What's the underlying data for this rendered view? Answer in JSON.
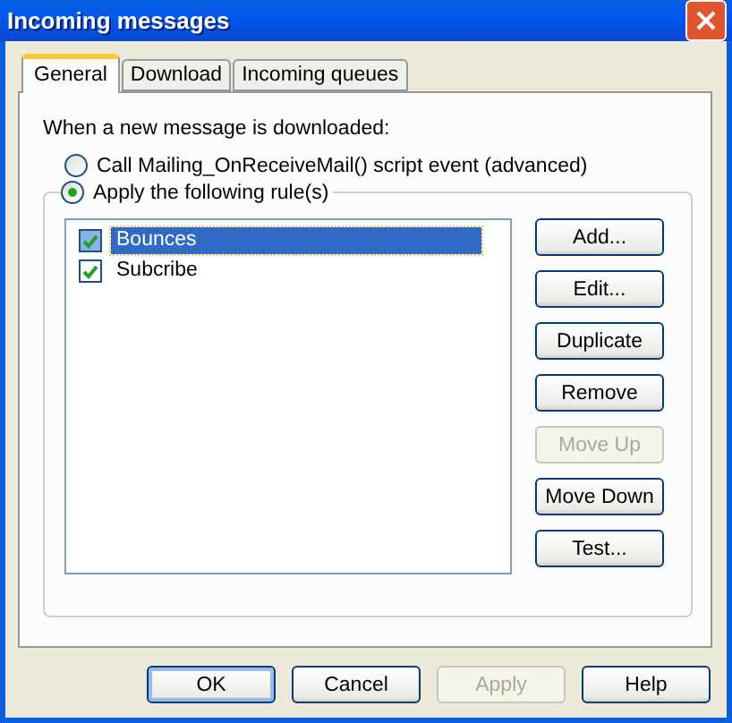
{
  "window": {
    "title": "Incoming messages"
  },
  "tabs": [
    {
      "label": "General",
      "selected": true
    },
    {
      "label": "Download",
      "selected": false
    },
    {
      "label": "Incoming queues",
      "selected": false
    }
  ],
  "intro": "When a new message is downloaded:",
  "options": [
    {
      "label": "Call Mailing_OnReceiveMail() script event (advanced)",
      "selected": false
    },
    {
      "label": "Apply the following rule(s)",
      "selected": true
    }
  ],
  "rules": [
    {
      "name": "Bounces",
      "checked": true,
      "selected": true
    },
    {
      "name": "Subcribe",
      "checked": true,
      "selected": false
    }
  ],
  "rule_buttons": [
    {
      "label": "Add...",
      "disabled": false
    },
    {
      "label": "Edit...",
      "disabled": false
    },
    {
      "label": "Duplicate",
      "disabled": false
    },
    {
      "label": "Remove",
      "disabled": false
    },
    {
      "label": "Move Up",
      "disabled": true
    },
    {
      "label": "Move Down",
      "disabled": false
    },
    {
      "label": "Test...",
      "disabled": false
    }
  ],
  "footer_buttons": [
    {
      "label": "OK",
      "default": true,
      "disabled": false
    },
    {
      "label": "Cancel",
      "default": false,
      "disabled": false
    },
    {
      "label": "Apply",
      "default": false,
      "disabled": true
    },
    {
      "label": "Help",
      "default": false,
      "disabled": false
    }
  ]
}
